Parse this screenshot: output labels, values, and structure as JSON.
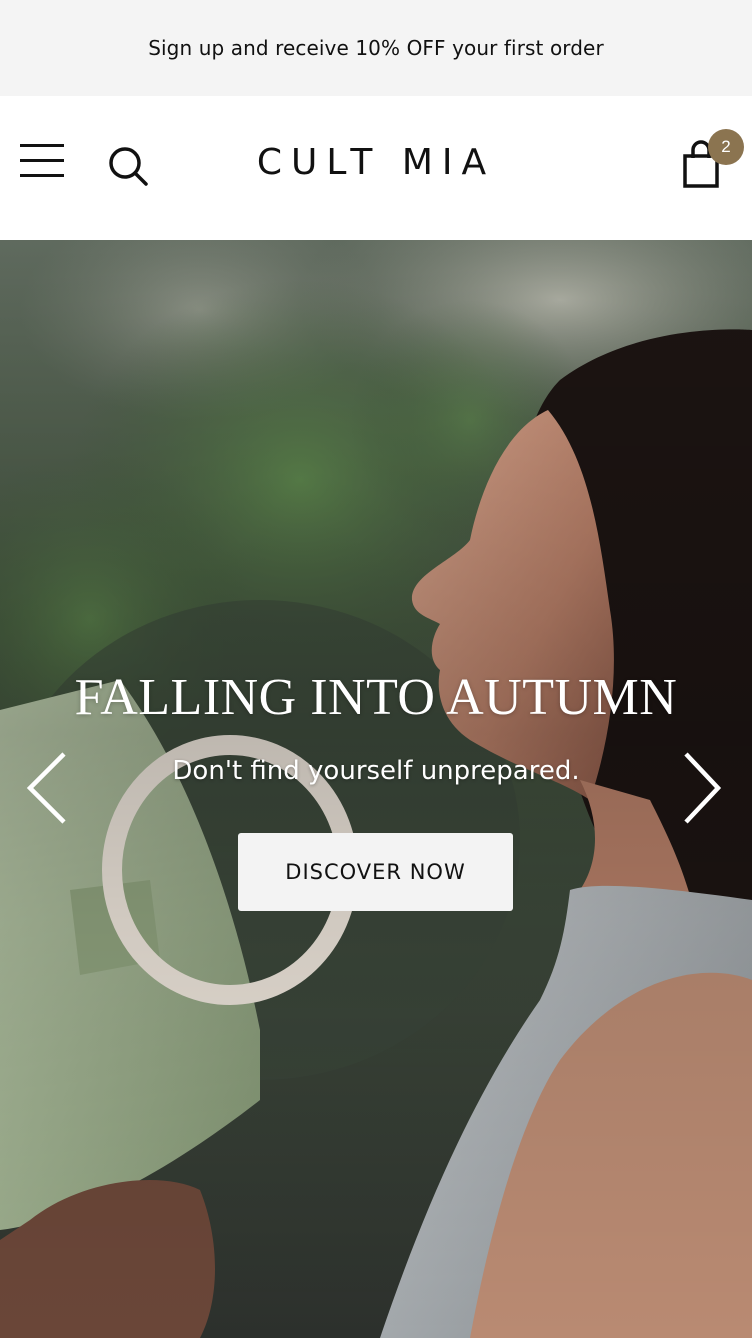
{
  "announcement": {
    "text": "Sign up and receive 10% OFF your first order"
  },
  "header": {
    "menu_icon": "hamburger-menu-icon",
    "search_icon": "search-icon",
    "logo": "CULT MIA",
    "cart_icon": "shopping-bag-icon",
    "cart_count": "2"
  },
  "hero": {
    "title": "FALLING INTO AUTUMN",
    "subtitle": "Don't find yourself unprepared.",
    "cta_label": "DISCOVER NOW",
    "prev_icon": "chevron-left-icon",
    "next_icon": "chevron-right-icon"
  },
  "colors": {
    "announcement_bg": "#f4f4f4",
    "badge": "#8b7450",
    "cta_bg": "#f3f3f3",
    "text": "#111111"
  }
}
